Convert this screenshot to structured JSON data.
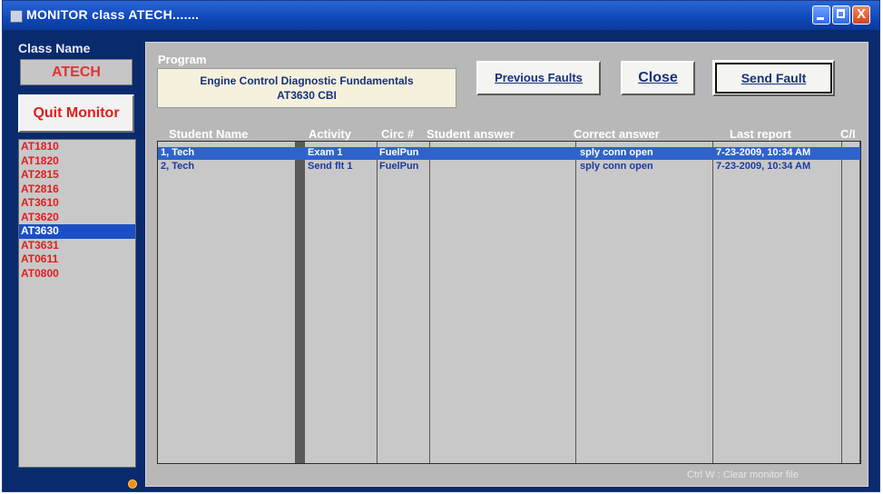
{
  "window": {
    "title": "MONITOR class ATECH.......",
    "close_glyph": "X"
  },
  "sidebar": {
    "class_name_label": "Class Name",
    "class_name_value": "ATECH",
    "quit_label": "Quit Monitor",
    "classes": [
      "AT1810",
      "AT1820",
      "AT2815",
      "AT2816",
      "AT3610",
      "AT3620",
      "AT3630",
      "AT3631",
      "AT0611",
      "AT0800"
    ],
    "selected_class": "AT3630"
  },
  "program": {
    "label": "Program",
    "line1": "Engine Control Diagnostic Fundamentals",
    "line2": "AT3630 CBI"
  },
  "buttons": {
    "previous_faults": "Previous Faults",
    "close": "Close",
    "send_fault": "Send Fault"
  },
  "table": {
    "headers": {
      "student_name": "Student Name",
      "activity": "Activity",
      "circ": "Circ #",
      "student_answer": "Student answer",
      "correct_answer": "Correct answer",
      "last_report": "Last report",
      "ci": "C/I"
    },
    "rows": [
      {
        "student_name": "1, Tech",
        "activity": "Exam 1",
        "circ": "FuelPun",
        "student_answer": "",
        "correct_answer": "sply conn open",
        "last_report": "7-23-2009, 10:34 AM",
        "ci": ""
      },
      {
        "student_name": "2, Tech",
        "activity": "Send flt 1",
        "circ": "FuelPun",
        "student_answer": "",
        "correct_answer": "sply conn open",
        "last_report": "7-23-2009, 10:34 AM",
        "ci": ""
      }
    ]
  },
  "footer": {
    "hint": "Ctrl W : Clear monitor file"
  },
  "colors": {
    "title_bar": "#0f48b8",
    "frame": "#0a2a6e",
    "selection": "#1a4ec4",
    "class_text": "#e01e1e",
    "button_text": "#17307a"
  }
}
